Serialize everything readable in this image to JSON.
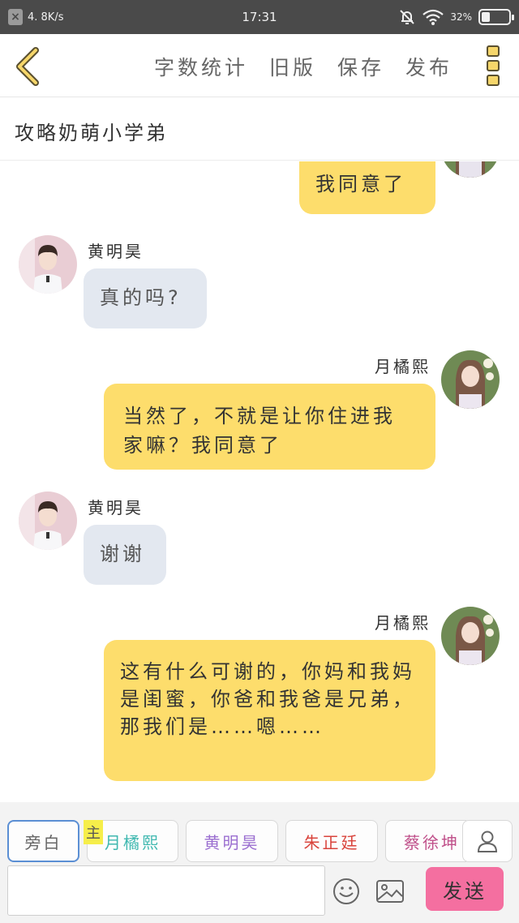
{
  "status": {
    "speed": "4. 8K/s",
    "time": "17:31",
    "battery": "32%",
    "battery_level": 0.32
  },
  "nav": {
    "stats": "字数统计",
    "old": "旧版",
    "save": "保存",
    "publish": "发布"
  },
  "title": "攻略奶萌小学弟",
  "messages": [
    {
      "side": "right",
      "speaker": "",
      "text": "我同意了"
    },
    {
      "side": "left",
      "speaker": "黄明昊",
      "text": "真的吗?"
    },
    {
      "side": "right",
      "speaker": "月橘熙",
      "text": "当然了，不就是让你住进我家嘛？我同意了"
    },
    {
      "side": "left",
      "speaker": "黄明昊",
      "text": "谢谢"
    },
    {
      "side": "right",
      "speaker": "月橘熙",
      "text": "这有什么可谢的，你妈和我妈是闺蜜，你爸和我爸是兄弟，那我们是……嗯……"
    }
  ],
  "roles": [
    {
      "label": "旁白",
      "color": "#666666"
    },
    {
      "label": "月橘熙",
      "color": "#3fb8b0",
      "badge": "主"
    },
    {
      "label": "黄明昊",
      "color": "#9b6fd0"
    },
    {
      "label": "朱正廷",
      "color": "#d9443c"
    },
    {
      "label": "蔡徐坤",
      "color": "#c0508a"
    }
  ],
  "composer": {
    "send": "发送"
  },
  "colors": {
    "my_bubble": "#fddd6c",
    "other_bubble": "#e3e8f0",
    "send": "#f46fa0"
  }
}
